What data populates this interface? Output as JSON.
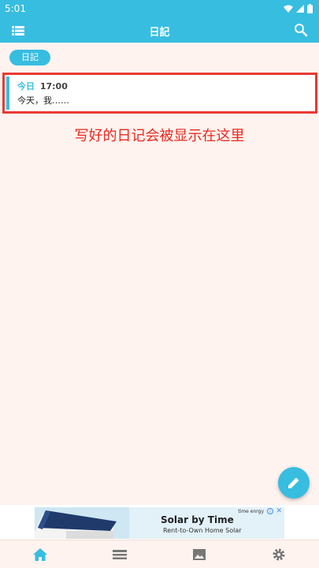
{
  "status_bar": {
    "time": "5:01"
  },
  "app_bar": {
    "title": "日記"
  },
  "tag": {
    "label": "日記"
  },
  "diary_entry": {
    "date_label": "今日",
    "time": "17:00",
    "preview": "今天，我……"
  },
  "annotation": {
    "text": "写好的日记会被显示在这里"
  },
  "ad": {
    "title": "Solar by Time",
    "subtitle": "Rent-to-Own Home Solar",
    "brand": "time enrgy"
  },
  "bottom_nav": {
    "items": [
      "home",
      "list",
      "image",
      "settings"
    ]
  },
  "colors": {
    "accent": "#37bde0",
    "background": "#fff3ef",
    "highlight_red": "#e83a33"
  }
}
